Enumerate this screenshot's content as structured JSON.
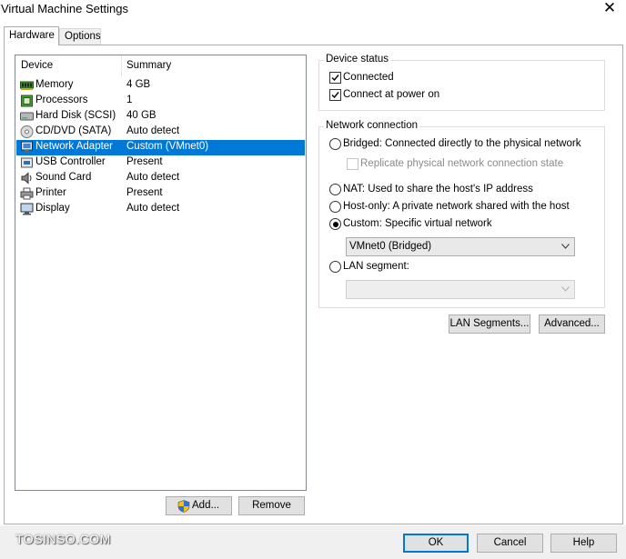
{
  "window": {
    "title": "Virtual Machine Settings",
    "close_label": "✕"
  },
  "tabs": [
    {
      "label": "Hardware",
      "active": true
    },
    {
      "label": "Options",
      "active": false
    }
  ],
  "device_list": {
    "columns": [
      "Device",
      "Summary"
    ],
    "rows": [
      {
        "device": "Memory",
        "summary": "4 GB",
        "icon": "memory-icon"
      },
      {
        "device": "Processors",
        "summary": "1",
        "icon": "processor-icon"
      },
      {
        "device": "Hard Disk (SCSI)",
        "summary": "40 GB",
        "icon": "hard-disk-icon"
      },
      {
        "device": "CD/DVD (SATA)",
        "summary": "Auto detect",
        "icon": "cd-dvd-icon"
      },
      {
        "device": "Network Adapter",
        "summary": "Custom (VMnet0)",
        "icon": "network-adapter-icon",
        "selected": true
      },
      {
        "device": "USB Controller",
        "summary": "Present",
        "icon": "usb-icon"
      },
      {
        "device": "Sound Card",
        "summary": "Auto detect",
        "icon": "sound-card-icon"
      },
      {
        "device": "Printer",
        "summary": "Present",
        "icon": "printer-icon"
      },
      {
        "device": "Display",
        "summary": "Auto detect",
        "icon": "display-icon"
      }
    ]
  },
  "list_buttons": {
    "add": "Add...",
    "remove": "Remove"
  },
  "device_status": {
    "legend": "Device status",
    "connected": {
      "label": "Connected",
      "checked": true
    },
    "connect_at_power_on": {
      "label": "Connect at power on",
      "checked": true
    }
  },
  "network_connection": {
    "legend": "Network connection",
    "bridged": {
      "label": "Bridged: Connected directly to the physical network",
      "selected": false
    },
    "replicate": {
      "label": "Replicate physical network connection state",
      "checked": false,
      "disabled": true
    },
    "nat": {
      "label": "NAT: Used to share the host's IP address",
      "selected": false
    },
    "host_only": {
      "label": "Host-only: A private network shared with the host",
      "selected": false
    },
    "custom": {
      "label": "Custom: Specific virtual network",
      "selected": true
    },
    "custom_network_value": "VMnet0 (Bridged)",
    "lan_segment": {
      "label": "LAN segment:",
      "selected": false
    },
    "lan_segment_value": ""
  },
  "network_buttons": {
    "lan_segments": "LAN Segments...",
    "advanced": "Advanced..."
  },
  "footer": {
    "ok": "OK",
    "cancel": "Cancel",
    "help": "Help",
    "watermark": "TOSINSO.COM"
  },
  "colors": {
    "selection": "#0078d7",
    "default_button_border": "#0078d7"
  }
}
